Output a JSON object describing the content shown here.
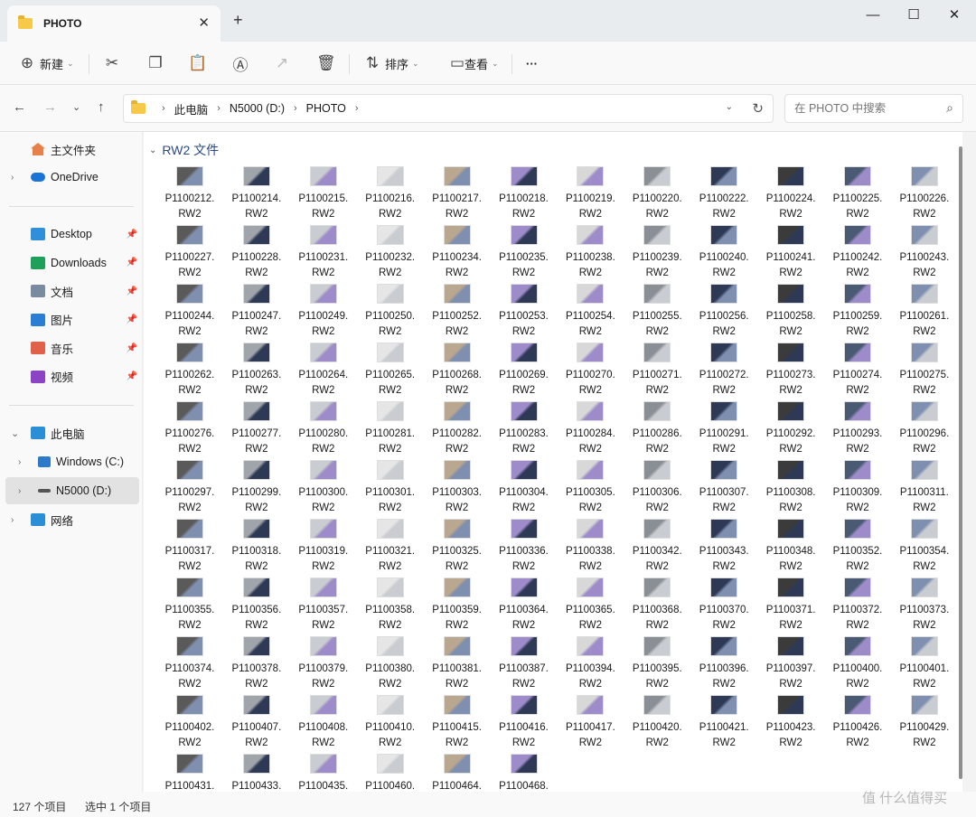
{
  "window": {
    "tab_title": "PHOTO",
    "tab_close": "✕",
    "new_tab": "+",
    "minimize": "—",
    "maximize": "☐",
    "close": "✕"
  },
  "toolbar": {
    "new_label": "新建",
    "sort_label": "排序",
    "view_label": "查看",
    "more_label": "···"
  },
  "address": {
    "crumbs": [
      "此电脑",
      "N5000 (D:)",
      "PHOTO"
    ],
    "search_placeholder": "在 PHOTO 中搜索"
  },
  "sidebar": {
    "home": "主文件夹",
    "onedrive": "OneDrive",
    "pinned": [
      {
        "label": "Desktop",
        "icon": "desktop-icon",
        "color": "#2f8fd8"
      },
      {
        "label": "Downloads",
        "icon": "download-icon",
        "color": "#1fa05a"
      },
      {
        "label": "文档",
        "icon": "document-icon",
        "color": "#7a8aa0"
      },
      {
        "label": "图片",
        "icon": "picture-icon",
        "color": "#2a7fd4"
      },
      {
        "label": "音乐",
        "icon": "music-icon",
        "color": "#e0604a"
      },
      {
        "label": "视频",
        "icon": "video-icon",
        "color": "#8b44c4"
      }
    ],
    "this_pc": "此电脑",
    "drive_c": "Windows (C:)",
    "drive_d": "N5000 (D:)",
    "network": "网络"
  },
  "group": {
    "label": "RW2 文件"
  },
  "files": [
    "P1100212.",
    "P1100214.",
    "P1100215.",
    "P1100216.",
    "P1100217.",
    "P1100218.",
    "P1100219.",
    "P1100220.",
    "P1100222.",
    "P1100224.",
    "P1100225.",
    "P1100226.",
    "P1100227.",
    "P1100228.",
    "P1100231.",
    "P1100232.",
    "P1100234.",
    "P1100235.",
    "P1100238.",
    "P1100239.",
    "P1100240.",
    "P1100241.",
    "P1100242.",
    "P1100243.",
    "P1100244.",
    "P1100247.",
    "P1100249.",
    "P1100250.",
    "P1100252.",
    "P1100253.",
    "P1100254.",
    "P1100255.",
    "P1100256.",
    "P1100258.",
    "P1100259.",
    "P1100261.",
    "P1100262.",
    "P1100263.",
    "P1100264.",
    "P1100265.",
    "P1100268.",
    "P1100269.",
    "P1100270.",
    "P1100271.",
    "P1100272.",
    "P1100273.",
    "P1100274.",
    "P1100275.",
    "P1100276.",
    "P1100277.",
    "P1100280.",
    "P1100281.",
    "P1100282.",
    "P1100283.",
    "P1100284.",
    "P1100286.",
    "P1100291.",
    "P1100292.",
    "P1100293.",
    "P1100296.",
    "P1100297.",
    "P1100299.",
    "P1100300.",
    "P1100301.",
    "P1100303.",
    "P1100304.",
    "P1100305.",
    "P1100306.",
    "P1100307.",
    "P1100308.",
    "P1100309.",
    "P1100311.",
    "P1100317.",
    "P1100318.",
    "P1100319.",
    "P1100321.",
    "P1100325.",
    "P1100336.",
    "P1100338.",
    "P1100342.",
    "P1100343.",
    "P1100348.",
    "P1100352.",
    "P1100354.",
    "P1100355.",
    "P1100356.",
    "P1100357.",
    "P1100358.",
    "P1100359.",
    "P1100364.",
    "P1100365.",
    "P1100368.",
    "P1100370.",
    "P1100371.",
    "P1100372.",
    "P1100373.",
    "P1100374.",
    "P1100378.",
    "P1100379.",
    "P1100380.",
    "P1100381.",
    "P1100387.",
    "P1100394.",
    "P1100395.",
    "P1100396.",
    "P1100397.",
    "P1100400.",
    "P1100401.",
    "P1100402.",
    "P1100407.",
    "P1100408.",
    "P1100410.",
    "P1100415.",
    "P1100416.",
    "P1100417.",
    "P1100420.",
    "P1100421.",
    "P1100423.",
    "P1100426.",
    "P1100429.",
    "P1100431.",
    "P1100433.",
    "P1100435.",
    "P1100460.",
    "P1100464.",
    "P1100468."
  ],
  "file_ext": "RW2",
  "status": {
    "count": "127 个项目",
    "selected": "选中 1 个项目"
  },
  "watermark": "值 什么值得买"
}
